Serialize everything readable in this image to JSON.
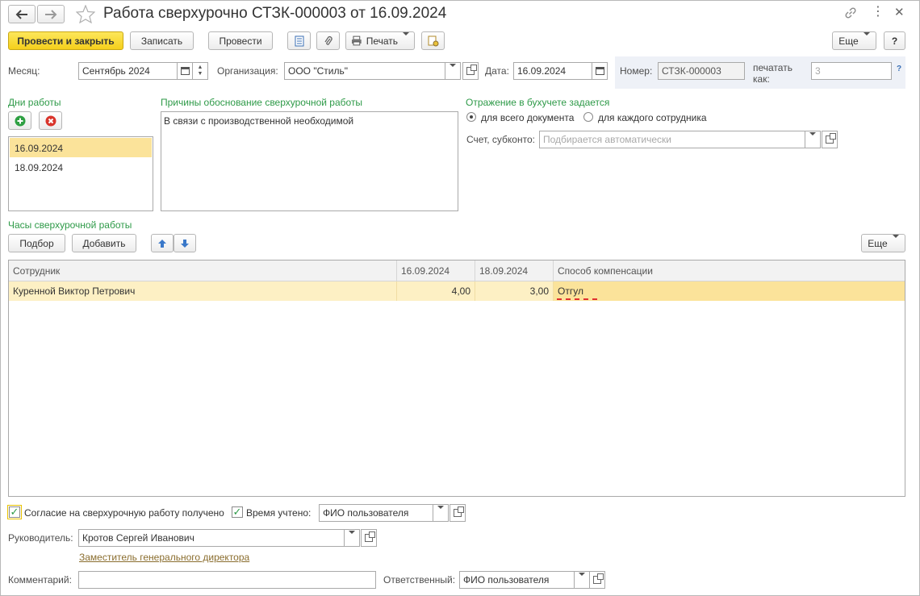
{
  "header": {
    "title": "Работа сверхурочно СТЗК-000003 от 16.09.2024",
    "back_icon": "arrow-left-icon",
    "forward_icon": "arrow-right-icon",
    "favorite_icon": "star-icon",
    "link_icon": "link-icon",
    "menu_icon": "more-vertical-icon",
    "close_icon": "close-icon"
  },
  "toolbar": {
    "post_close": "Провести и закрыть",
    "save": "Записать",
    "post": "Провести",
    "print": "Печать",
    "more": "Еще",
    "help": "?"
  },
  "fields": {
    "month_label": "Месяц:",
    "month_value": "Сентябрь 2024",
    "org_label": "Организация:",
    "org_value": "ООО \"Стиль\"",
    "date_label": "Дата:",
    "date_value": "16.09.2024",
    "number_label": "Номер:",
    "number_value": "СТЗК-000003",
    "print_as_label_1": "печатать",
    "print_as_label_2": "как:",
    "print_as_value": "3",
    "print_as_help": "?"
  },
  "work_days": {
    "title": "Дни работы",
    "items": [
      "16.09.2024",
      "18.09.2024"
    ],
    "selected_index": 0
  },
  "reasons": {
    "title": "Причины обоснование сверхурочной работы",
    "text": "В связи с производственной необходимой"
  },
  "accounting": {
    "title": "Отражение в бухучете задается",
    "option_document": "для всего документа",
    "option_employee": "для каждого сотрудника",
    "selected": "document",
    "account_label": "Счет, субконто:",
    "account_placeholder": "Подбирается автоматически"
  },
  "hours": {
    "title": "Часы сверхурочной работы",
    "select_button": "Подбор",
    "add_button": "Добавить",
    "more_button": "Еще",
    "columns": [
      "Сотрудник",
      "16.09.2024",
      "18.09.2024",
      "Способ компенсации"
    ],
    "rows": [
      {
        "employee": "Куренной Виктор Петрович",
        "d1": "4,00",
        "d2": "3,00",
        "compensation": "Отгул"
      }
    ]
  },
  "footer": {
    "consent_label": "Согласие на сверхурочную работу получено",
    "consent_checked": true,
    "time_label": "Время учтено:",
    "time_checked": true,
    "time_user": "ФИО пользователя",
    "manager_label": "Руководитель:",
    "manager_value": "Кротов Сергей Иванович",
    "manager_position": "Заместитель генерального директора",
    "comment_label": "Комментарий:",
    "comment_value": "",
    "responsible_label": "Ответственный:",
    "responsible_value": "ФИО пользователя"
  },
  "colors": {
    "primary_button": "#f5cf1b",
    "selected_row": "#fbe39a",
    "group_title": "#2e9a48",
    "link": "#8a6d2e",
    "invalid_underline": "#e03030"
  }
}
